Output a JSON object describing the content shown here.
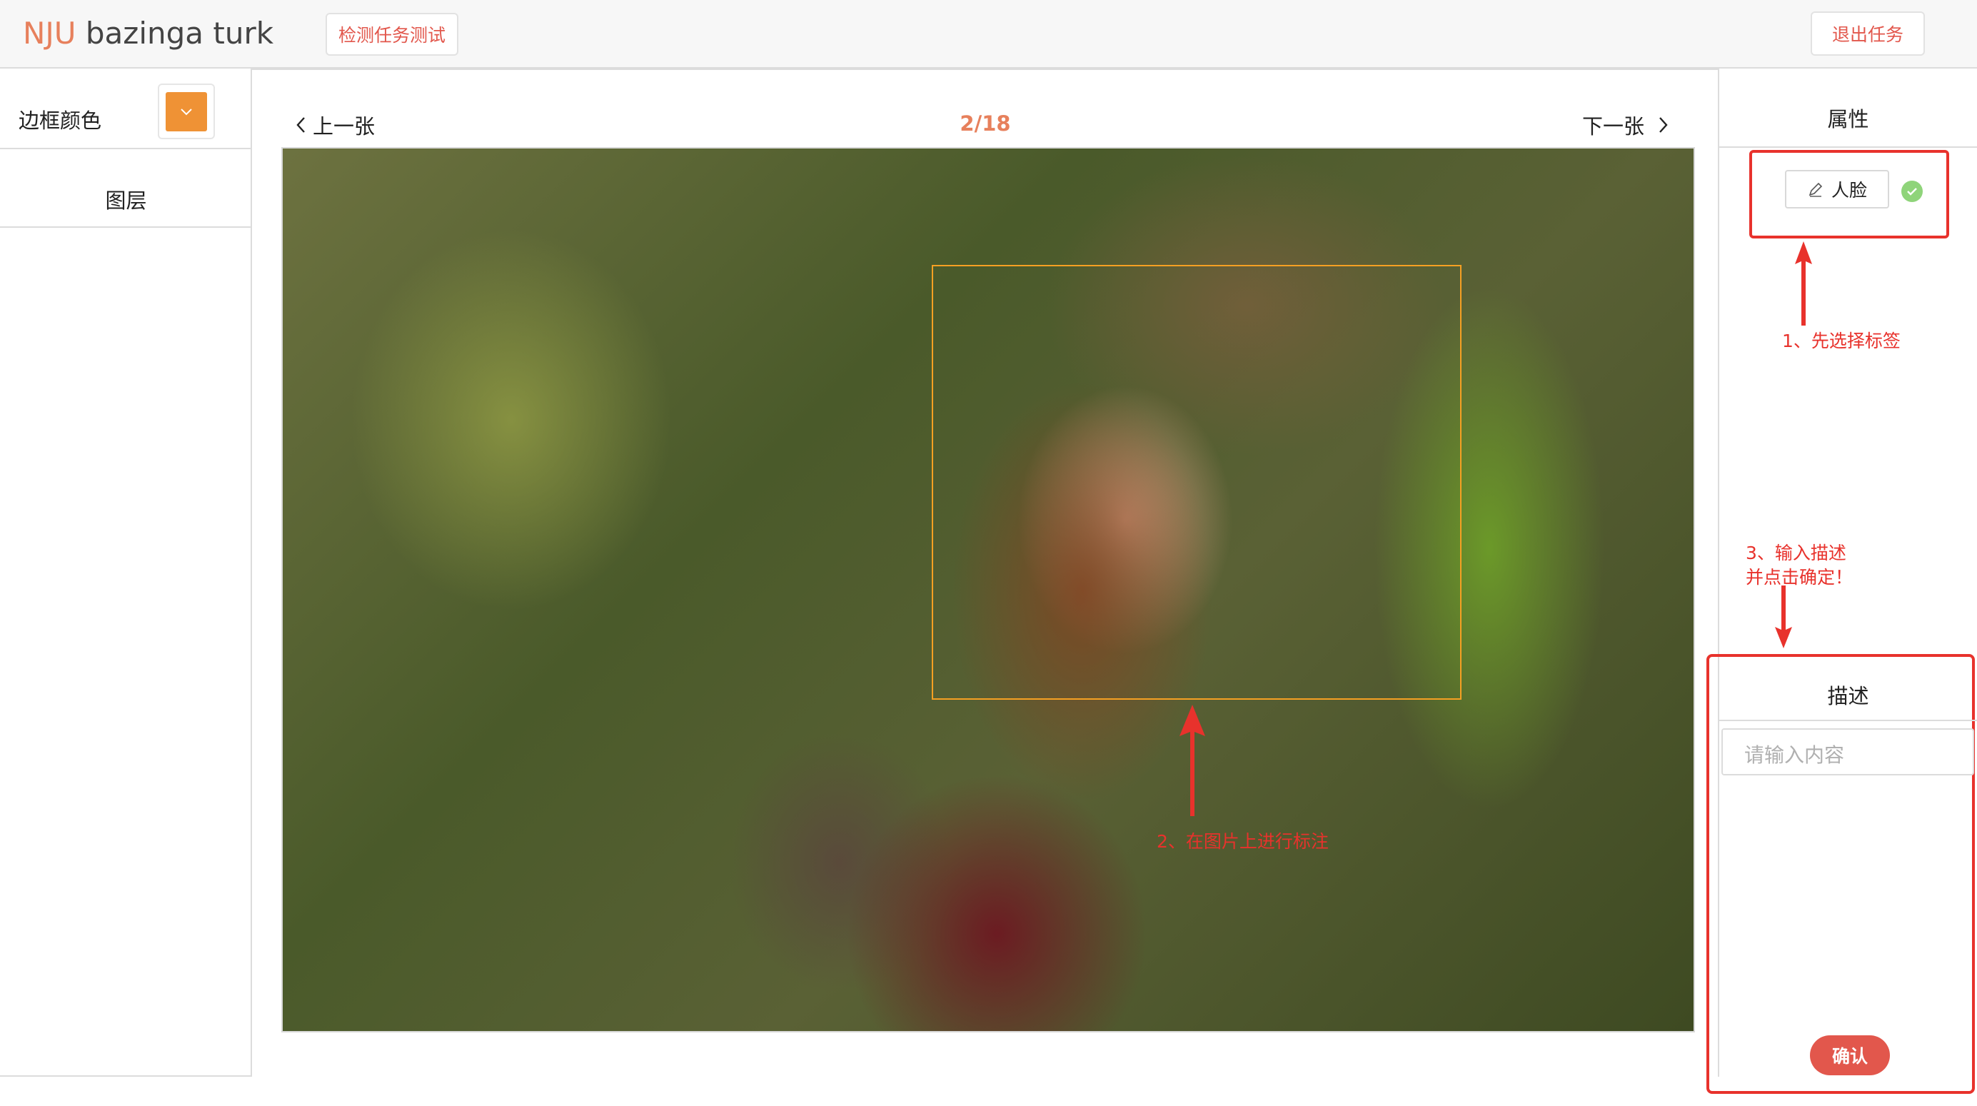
{
  "app": {
    "brand_prefix": "NJU",
    "brand_suffix": " bazinga turk"
  },
  "header": {
    "test_button": "检测任务测试",
    "exit_button": "退出任务"
  },
  "left_panel": {
    "border_color_label": "边框颜色",
    "border_color_value": "#ef9235",
    "layers_label": "图层"
  },
  "viewer": {
    "prev_label": "上一张",
    "next_label": "下一张",
    "counter": "2/18",
    "counter_color": "#e7805c",
    "box_color": "#f5a023"
  },
  "right_panel": {
    "attributes_title": "属性",
    "label_tag": "人脸",
    "description_title": "描述",
    "description_placeholder": "请输入内容",
    "description_value": "",
    "confirm_button": "确认"
  },
  "annotations": {
    "step1": "1、先选择标签",
    "step2": "2、在图片上进行标注",
    "step3_line1": "3、输入描述",
    "step3_line2": "并点击确定！",
    "color": "#e8322c"
  },
  "icons": [
    "chevron-down-icon",
    "chevron-left-icon",
    "chevron-right-icon",
    "pencil-icon",
    "check-circle-icon",
    "arrow-up-icon",
    "arrow-down-icon"
  ]
}
